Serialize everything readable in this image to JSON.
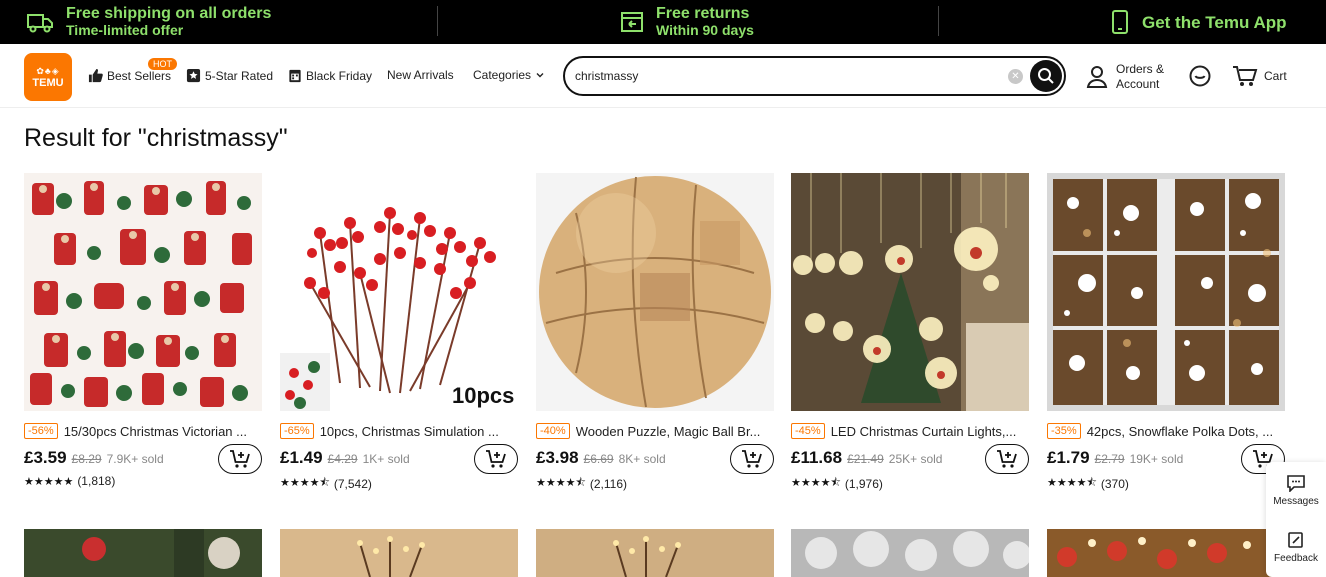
{
  "promo": {
    "shipping_l1": "Free shipping on all orders",
    "shipping_l2": "Time-limited offer",
    "returns_l1": "Free returns",
    "returns_l2": "Within 90 days",
    "app": "Get the Temu App"
  },
  "nav": {
    "logo": "TEMU",
    "hot_badge": "HOT",
    "best_sellers": "Best Sellers",
    "five_star": "5-Star Rated",
    "black_friday": "Black Friday",
    "new_arrivals": "New Arrivals",
    "categories": "Categories",
    "orders_l1": "Orders &",
    "orders_l2": "Account",
    "cart": "Cart"
  },
  "search": {
    "value": "christmassy"
  },
  "heading": "Result for \"christmassy\"",
  "products": [
    {
      "discount": "-56%",
      "title": "15/30pcs Christmas Victorian ...",
      "price": "£3.59",
      "old_price": "£8.29",
      "sold": "7.9K+ sold",
      "stars": 5,
      "reviews": "(1,818)"
    },
    {
      "discount": "-65%",
      "title": "10pcs, Christmas Simulation ...",
      "price": "£1.49",
      "old_price": "£4.29",
      "sold": "1K+ sold",
      "stars": 4.5,
      "reviews": "(7,542)",
      "overlay": "10pcs"
    },
    {
      "discount": "-40%",
      "title": "Wooden Puzzle, Magic Ball Br...",
      "price": "£3.98",
      "old_price": "£6.69",
      "sold": "8K+ sold",
      "stars": 4.5,
      "reviews": "(2,116)"
    },
    {
      "discount": "-45%",
      "title": "LED Christmas Curtain Lights,...",
      "price": "£11.68",
      "old_price": "£21.49",
      "sold": "25K+ sold",
      "stars": 4.5,
      "reviews": "(1,976)"
    },
    {
      "discount": "-35%",
      "title": "42pcs, Snowflake Polka Dots, ...",
      "price": "£1.79",
      "old_price": "£2.79",
      "sold": "19K+ sold",
      "stars": 4.5,
      "reviews": "(370)"
    }
  ],
  "side": {
    "messages": "Messages",
    "feedback": "Feedback"
  },
  "colors": {
    "accent": "#fb7701",
    "promo_text": "#8ee06b",
    "promo_bg": "#000000"
  }
}
